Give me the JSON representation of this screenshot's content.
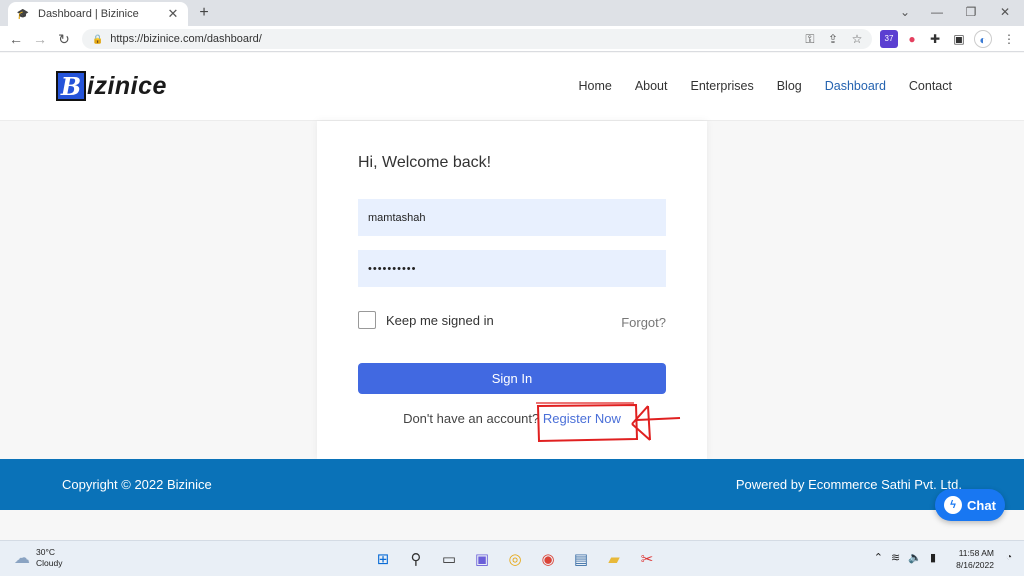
{
  "browser": {
    "tab_title": "Dashboard | Bizinice",
    "tab_close": "✕",
    "new_tab": "+",
    "url": "https://bizinice.com/dashboard/",
    "profile_badge": "37",
    "window_controls": [
      "⌄",
      "—",
      "❐",
      "✕"
    ]
  },
  "site": {
    "logo_letter": "B",
    "logo_rest": "izinice",
    "nav": [
      "Home",
      "About",
      "Enterprises",
      "Blog",
      "Dashboard",
      "Contact"
    ],
    "active_nav": "Dashboard"
  },
  "login": {
    "welcome": "Hi, Welcome back!",
    "username_value": "mamtashah",
    "password_value": "••••••••••",
    "remember_label": "Keep me signed in",
    "forgot_label": "Forgot?",
    "signin_label": "Sign In",
    "no_account_text": "Don't have an account?",
    "register_label": "Register Now"
  },
  "footer": {
    "copyright": "Copyright © 2022 Bizinice",
    "powered": "Powered by Ecommerce Sathi Pvt. Ltd."
  },
  "chat": {
    "label": "Chat"
  },
  "taskbar": {
    "temperature": "30°C",
    "weather": "Cloudy",
    "time": "11:58 AM",
    "date": "8/16/2022"
  },
  "colors": {
    "accent": "#4169e1",
    "footer": "#0a72b8",
    "annotation": "#e02020",
    "chat": "#1877f2"
  }
}
